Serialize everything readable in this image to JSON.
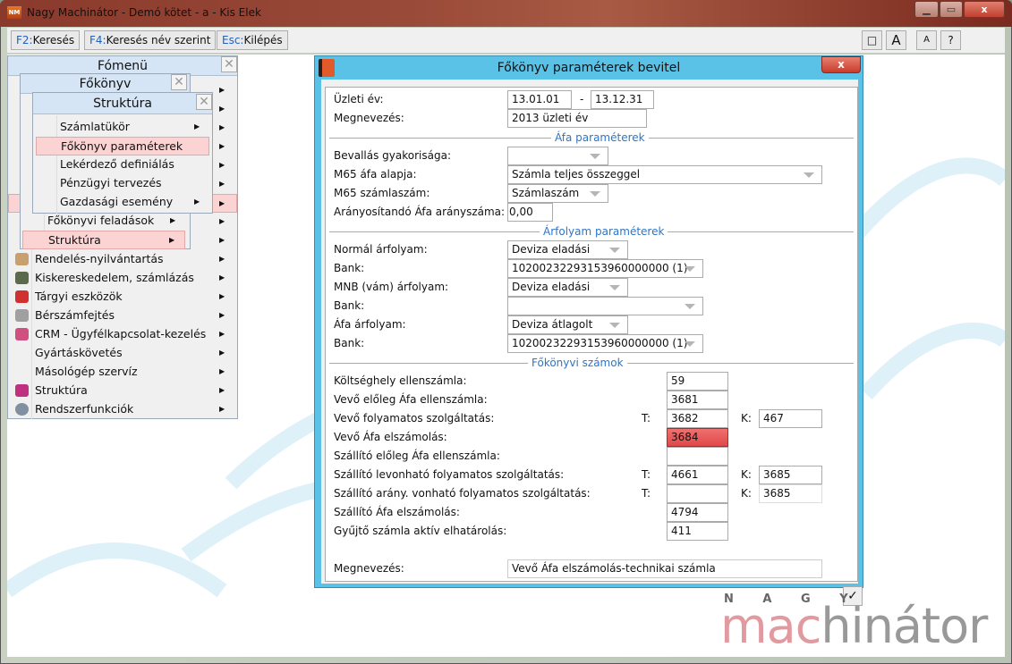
{
  "window": {
    "title": "Nagy Machinátor - Demó kötet - a - Kis Elek",
    "app_icon": "NM",
    "min": "▁",
    "max": "▭",
    "close": "x"
  },
  "toolbar": {
    "buttons": [
      {
        "key": "F2:",
        "label": "Keresés"
      },
      {
        "key": "F4:",
        "label": "Keresés név szerint"
      },
      {
        "key": "Esc:",
        "label": "Kilépés"
      }
    ],
    "right": [
      "□",
      "A",
      "A",
      "?"
    ]
  },
  "fomenu": {
    "title": "Fómenü",
    "close": "✕",
    "items": [
      {
        "label": "Rendelés-nyilvántartás",
        "color": "#c8a070"
      },
      {
        "label": "Kiskereskedelem, számlázás",
        "color": "#5a6a4a"
      },
      {
        "label": "Tárgyi eszközök",
        "color": "#d03030"
      },
      {
        "label": "Bérszámfejtés",
        "color": "#a0a0a0"
      },
      {
        "label": "CRM - Ügyfélkapcsolat-kezelés",
        "color": "#d05080"
      },
      {
        "label": "Gyártáskövetés",
        "color": ""
      },
      {
        "label": "Másológép szervíz",
        "color": ""
      },
      {
        "label": "Struktúra",
        "color": "#c03080"
      },
      {
        "label": "Rendszerfunkciók",
        "color": "#8090a0"
      }
    ]
  },
  "fokonyv": {
    "title": "Főkönyv",
    "close": "✕",
    "items": [
      {
        "label": "Főkönyvi feladások"
      },
      {
        "label": "Struktúra"
      }
    ]
  },
  "struktura": {
    "title": "Struktúra",
    "close": "✕",
    "items": [
      {
        "label": "Számlatükör"
      },
      {
        "label": "Főkönyv paraméterek"
      },
      {
        "label": "Lekérdező definiálás"
      },
      {
        "label": "Pénzügyi tervezés"
      },
      {
        "label": "Gazdasági esemény"
      }
    ]
  },
  "dialog": {
    "title": "Főkönyv paraméterek bevitel",
    "close": "x",
    "confirm": "✓",
    "uzleti_ev": {
      "label": "Üzleti év:",
      "from": "13.01.01",
      "dash": "-",
      "to": "13.12.31"
    },
    "megnevezes": {
      "label": "Megnevezés:",
      "value": "2013 üzleti év"
    },
    "afa_section": "Áfa paraméterek",
    "bevallas": {
      "label": "Bevallás gyakorisága:",
      "value": ""
    },
    "m65_alap": {
      "label": "M65 áfa alapja:",
      "value": "Számla teljes összeggel"
    },
    "m65_szam": {
      "label": "M65 számlaszám:",
      "value": "Számlaszám"
    },
    "aranyositando": {
      "label": "Arányosítandó Áfa arányszáma:",
      "value": "0,00"
    },
    "arfolyam_section": "Árfolyam paraméterek",
    "normal": {
      "label": "Normál árfolyam:",
      "value": "Deviza eladási"
    },
    "bank1": {
      "label": "Bank:",
      "value": "10200232293153960000000 (1)"
    },
    "mnb": {
      "label": "MNB (vám) árfolyam:",
      "value": "Deviza eladási"
    },
    "bank2": {
      "label": "Bank:",
      "value": ""
    },
    "afa_arf": {
      "label": "Áfa árfolyam:",
      "value": "Deviza átlagolt"
    },
    "bank3": {
      "label": "Bank:",
      "value": "10200232293153960000000 (1)"
    },
    "fokonyvi_section": "Főkönyvi számok",
    "t_label": "T:",
    "k_label": "K:",
    "accounts": [
      {
        "label": "Költséghely ellenszámla:",
        "t": "59"
      },
      {
        "label": "Vevő előleg Áfa ellenszámla:",
        "t": "3681"
      },
      {
        "label": "Vevő folyamatos szolgáltatás:",
        "t": "3682",
        "k": "467"
      },
      {
        "label": "Vevő Áfa elszámolás:",
        "t": "3684"
      },
      {
        "label": "Szállító előleg Áfa ellenszámla:",
        "t": ""
      },
      {
        "label": "Szállító levonható folyamatos szolgáltatás:",
        "t": "4661",
        "k": "3685"
      },
      {
        "label": "Szállító arány. vonható folyamatos szolgáltatás:",
        "t": "",
        "k": "3685"
      },
      {
        "label": "Szállító Áfa elszámolás:",
        "t": "4794"
      },
      {
        "label": "Gyűjtő számla aktív elhatárolás:",
        "t": "411"
      }
    ],
    "megnevezes2": {
      "label": "Megnevezés:",
      "value": "Vevő Áfa elszámolás-technikai számla"
    }
  },
  "logo": {
    "top": "N A G Y",
    "part1": "mac",
    "part2": "hinátor"
  }
}
